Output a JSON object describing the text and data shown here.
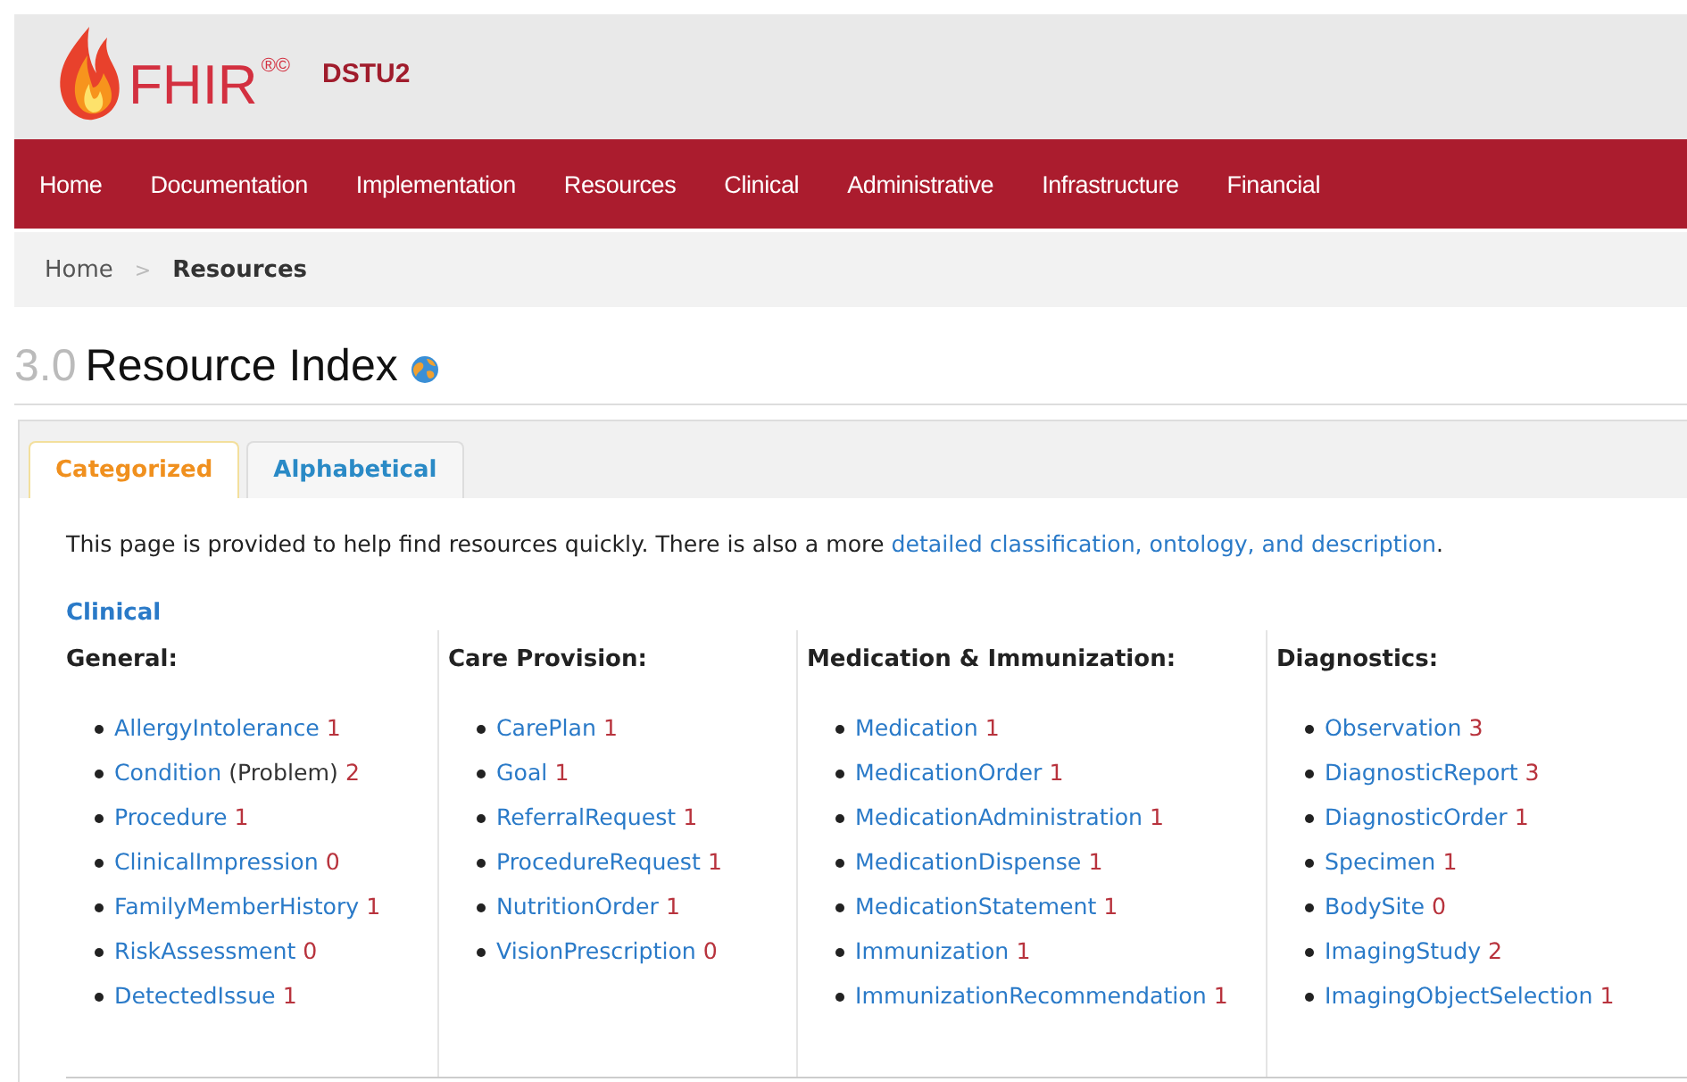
{
  "logo": {
    "name": "FHIR",
    "marks": "®©",
    "version": "DSTU2"
  },
  "nav": [
    {
      "label": "Home"
    },
    {
      "label": "Documentation"
    },
    {
      "label": "Implementation"
    },
    {
      "label": "Resources"
    },
    {
      "label": "Clinical"
    },
    {
      "label": "Administrative"
    },
    {
      "label": "Infrastructure"
    },
    {
      "label": "Financial"
    }
  ],
  "breadcrumb": [
    {
      "label": "Home",
      "current": false
    },
    {
      "label": "Resources",
      "current": true
    }
  ],
  "breadcrumb_separator": ">",
  "heading": {
    "number": "3.0",
    "title": "Resource Index"
  },
  "tabs": [
    {
      "label": "Categorized",
      "selected": true
    },
    {
      "label": "Alphabetical",
      "selected": false
    }
  ],
  "intro": {
    "text": "This page is provided to help find resources quickly. There is also a more",
    "link": "detailed classification, ontology, and description",
    "end": "."
  },
  "section": "Clinical",
  "columns": [
    {
      "title": "General:",
      "items": [
        {
          "name": "AllergyIntolerance",
          "count": "1"
        },
        {
          "name": "Condition",
          "note": "(Problem)",
          "count": "2"
        },
        {
          "name": "Procedure",
          "count": "1"
        },
        {
          "name": "ClinicalImpression",
          "count": "0"
        },
        {
          "name": "FamilyMemberHistory",
          "count": "1"
        },
        {
          "name": "RiskAssessment",
          "count": "0"
        },
        {
          "name": "DetectedIssue",
          "count": "1"
        }
      ]
    },
    {
      "title": "Care Provision:",
      "items": [
        {
          "name": "CarePlan",
          "count": "1"
        },
        {
          "name": "Goal",
          "count": "1"
        },
        {
          "name": "ReferralRequest",
          "count": "1"
        },
        {
          "name": "ProcedureRequest",
          "count": "1"
        },
        {
          "name": "NutritionOrder",
          "count": "1"
        },
        {
          "name": "VisionPrescription",
          "count": "0"
        }
      ]
    },
    {
      "title": "Medication & Immunization:",
      "items": [
        {
          "name": "Medication",
          "count": "1"
        },
        {
          "name": "MedicationOrder",
          "count": "1"
        },
        {
          "name": "MedicationAdministration",
          "count": "1"
        },
        {
          "name": "MedicationDispense",
          "count": "1"
        },
        {
          "name": "MedicationStatement",
          "count": "1"
        },
        {
          "name": "Immunization",
          "count": "1"
        },
        {
          "name": "ImmunizationRecommendation",
          "count": "1"
        }
      ]
    },
    {
      "title": "Diagnostics:",
      "items": [
        {
          "name": "Observation",
          "count": "3"
        },
        {
          "name": "DiagnosticReport",
          "count": "3"
        },
        {
          "name": "DiagnosticOrder",
          "count": "1"
        },
        {
          "name": "Specimen",
          "count": "1"
        },
        {
          "name": "BodySite",
          "count": "0"
        },
        {
          "name": "ImagingStudy",
          "count": "2"
        },
        {
          "name": "ImagingObjectSelection",
          "count": "1"
        }
      ]
    }
  ]
}
